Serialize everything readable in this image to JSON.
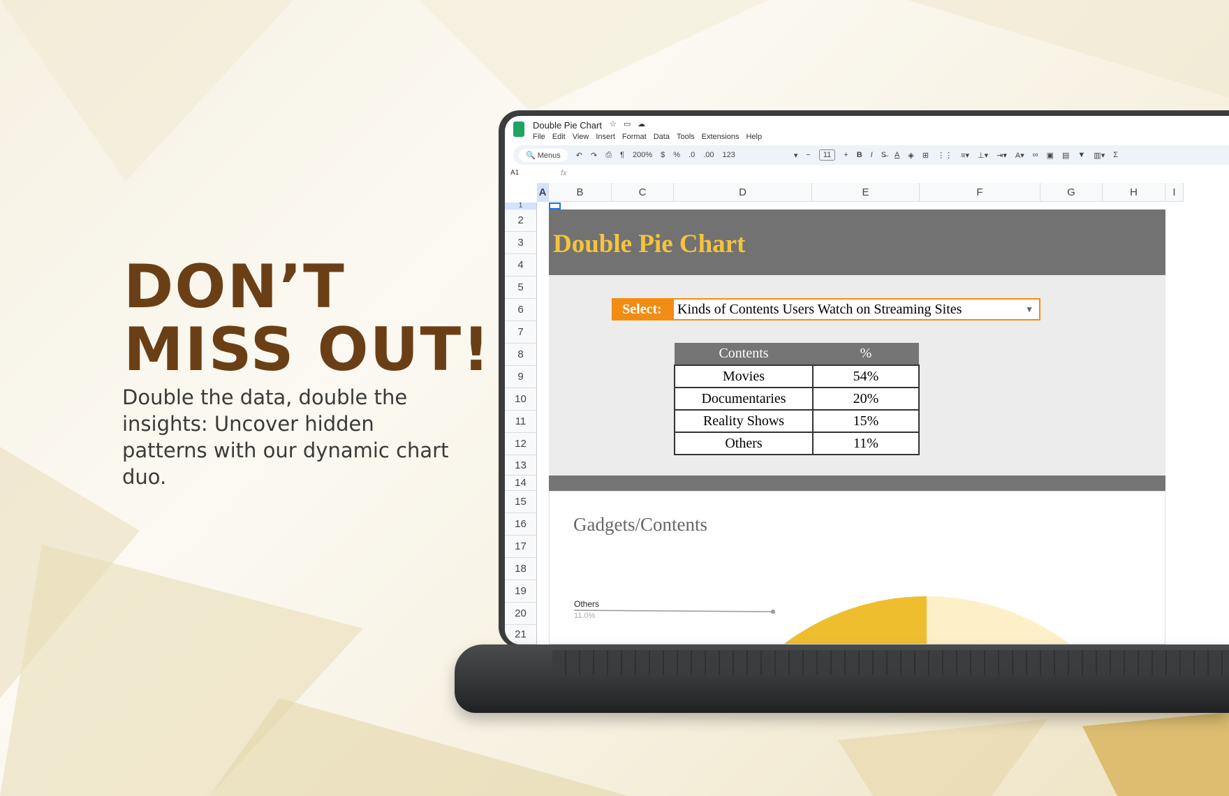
{
  "promo": {
    "headline_line1": "DON’T",
    "headline_line2": "MISS OUT!",
    "body": "Double the data, double the insights: Uncover hidden patterns with our dynamic chart duo."
  },
  "app": {
    "doc_title": "Double Pie Chart",
    "menu": [
      "File",
      "Edit",
      "View",
      "Insert",
      "Format",
      "Data",
      "Tools",
      "Extensions",
      "Help"
    ],
    "toolbar": {
      "search": "Menus",
      "zoom": "200%",
      "currency": "$",
      "percent": "%",
      "dec_less": ".0",
      "dec_more": ".00",
      "format": "123",
      "font_size": "11",
      "bold": "B",
      "italic": "I",
      "sum": "Σ"
    },
    "name_box": "A1",
    "fx": "fx"
  },
  "columns": [
    "A",
    "B",
    "C",
    "D",
    "E",
    "F",
    "G",
    "H",
    "I"
  ],
  "rows": [
    "1",
    "2",
    "3",
    "4",
    "5",
    "6",
    "7",
    "8",
    "9",
    "10",
    "11",
    "12",
    "13",
    "14",
    "15",
    "16",
    "17",
    "18",
    "19",
    "20",
    "21"
  ],
  "sheet": {
    "banner_title": "Double Pie Chart",
    "select_label": "Select:",
    "select_value": "Kinds of Contents Users Watch on Streaming Sites",
    "table": {
      "headers": [
        "Contents",
        "%"
      ],
      "rows": [
        [
          "Movies",
          "54%"
        ],
        [
          "Documentaries",
          "20%"
        ],
        [
          "Reality Shows",
          "15%"
        ],
        [
          "Others",
          "11%"
        ]
      ]
    }
  },
  "chart_data": {
    "type": "pie",
    "title": "Gadgets/Contents",
    "categories": [
      "Movies",
      "Documentaries",
      "Reality Shows",
      "Others"
    ],
    "values": [
      54,
      20,
      15,
      11
    ],
    "colors": [
      "#fdf0c8",
      "#fbe08a",
      "#f8cc55",
      "#efbe2e"
    ],
    "visible_label": {
      "name": "Others",
      "value": "11.0%"
    }
  },
  "colors": {
    "accent": "#f28c13",
    "banner": "#727272",
    "title_yellow": "#f6c43c",
    "brand": "#6b3f16"
  }
}
